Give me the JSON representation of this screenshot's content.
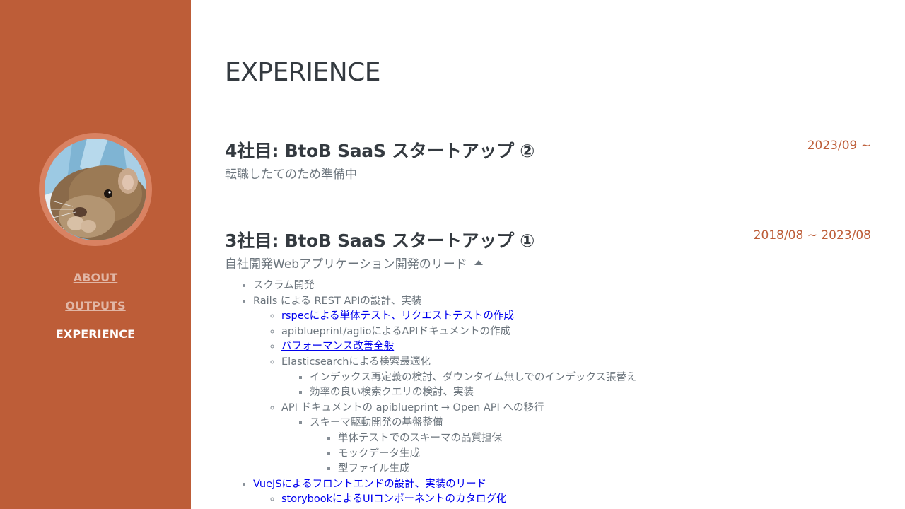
{
  "sidebar": {
    "nav": [
      {
        "label": "ABOUT"
      },
      {
        "label": "OUTPUTS"
      },
      {
        "label": "EXPERIENCE"
      }
    ],
    "colors": {
      "background": "#bd5d38",
      "ring": "#d98262"
    }
  },
  "main": {
    "title": "EXPERIENCE",
    "jobs": [
      {
        "title": "4社目: BtoB SaaS スタートアップ ②",
        "subtitle": "転職したてのため準備中",
        "date": "2023/09 ~"
      },
      {
        "title": "3社目: BtoB SaaS スタートアップ ①",
        "subtitle": "自社開発Webアプリケーション開発のリード",
        "date": "2018/08 ~ 2023/08",
        "tasks": {
          "scrum": "スクラム開発",
          "rails": "Rails による REST APIの設計、実装",
          "rspec": "rspecによる単体テスト、リクエストテストの作成",
          "apiblueprint": "apiblueprint/aglioによるAPIドキュメントの作成",
          "performance": "パフォーマンス改善全般",
          "elasticsearch": "Elasticsearchによる検索最適化",
          "reindex": "インデックス再定義の検討、ダウンタイム無しでのインデックス張替え",
          "query": "効率の良い検索クエリの検討、実装",
          "openapi": "API ドキュメントの apiblueprint → Open API への移行",
          "schema": "スキーマ駆動開発の基盤整備",
          "schema_test": "単体テストでのスキーマの品質担保",
          "mock": "モックデータ生成",
          "typefile": "型ファイル生成",
          "vue": "VueJSによるフロントエンドの設計、実装のリード",
          "storybook": "storybookによるUIコンポーネントのカタログ化"
        }
      }
    ],
    "colors": {
      "heading": "#343a40",
      "muted": "#6c757d",
      "accent": "#bd5d38",
      "link": "#0000ee"
    }
  }
}
